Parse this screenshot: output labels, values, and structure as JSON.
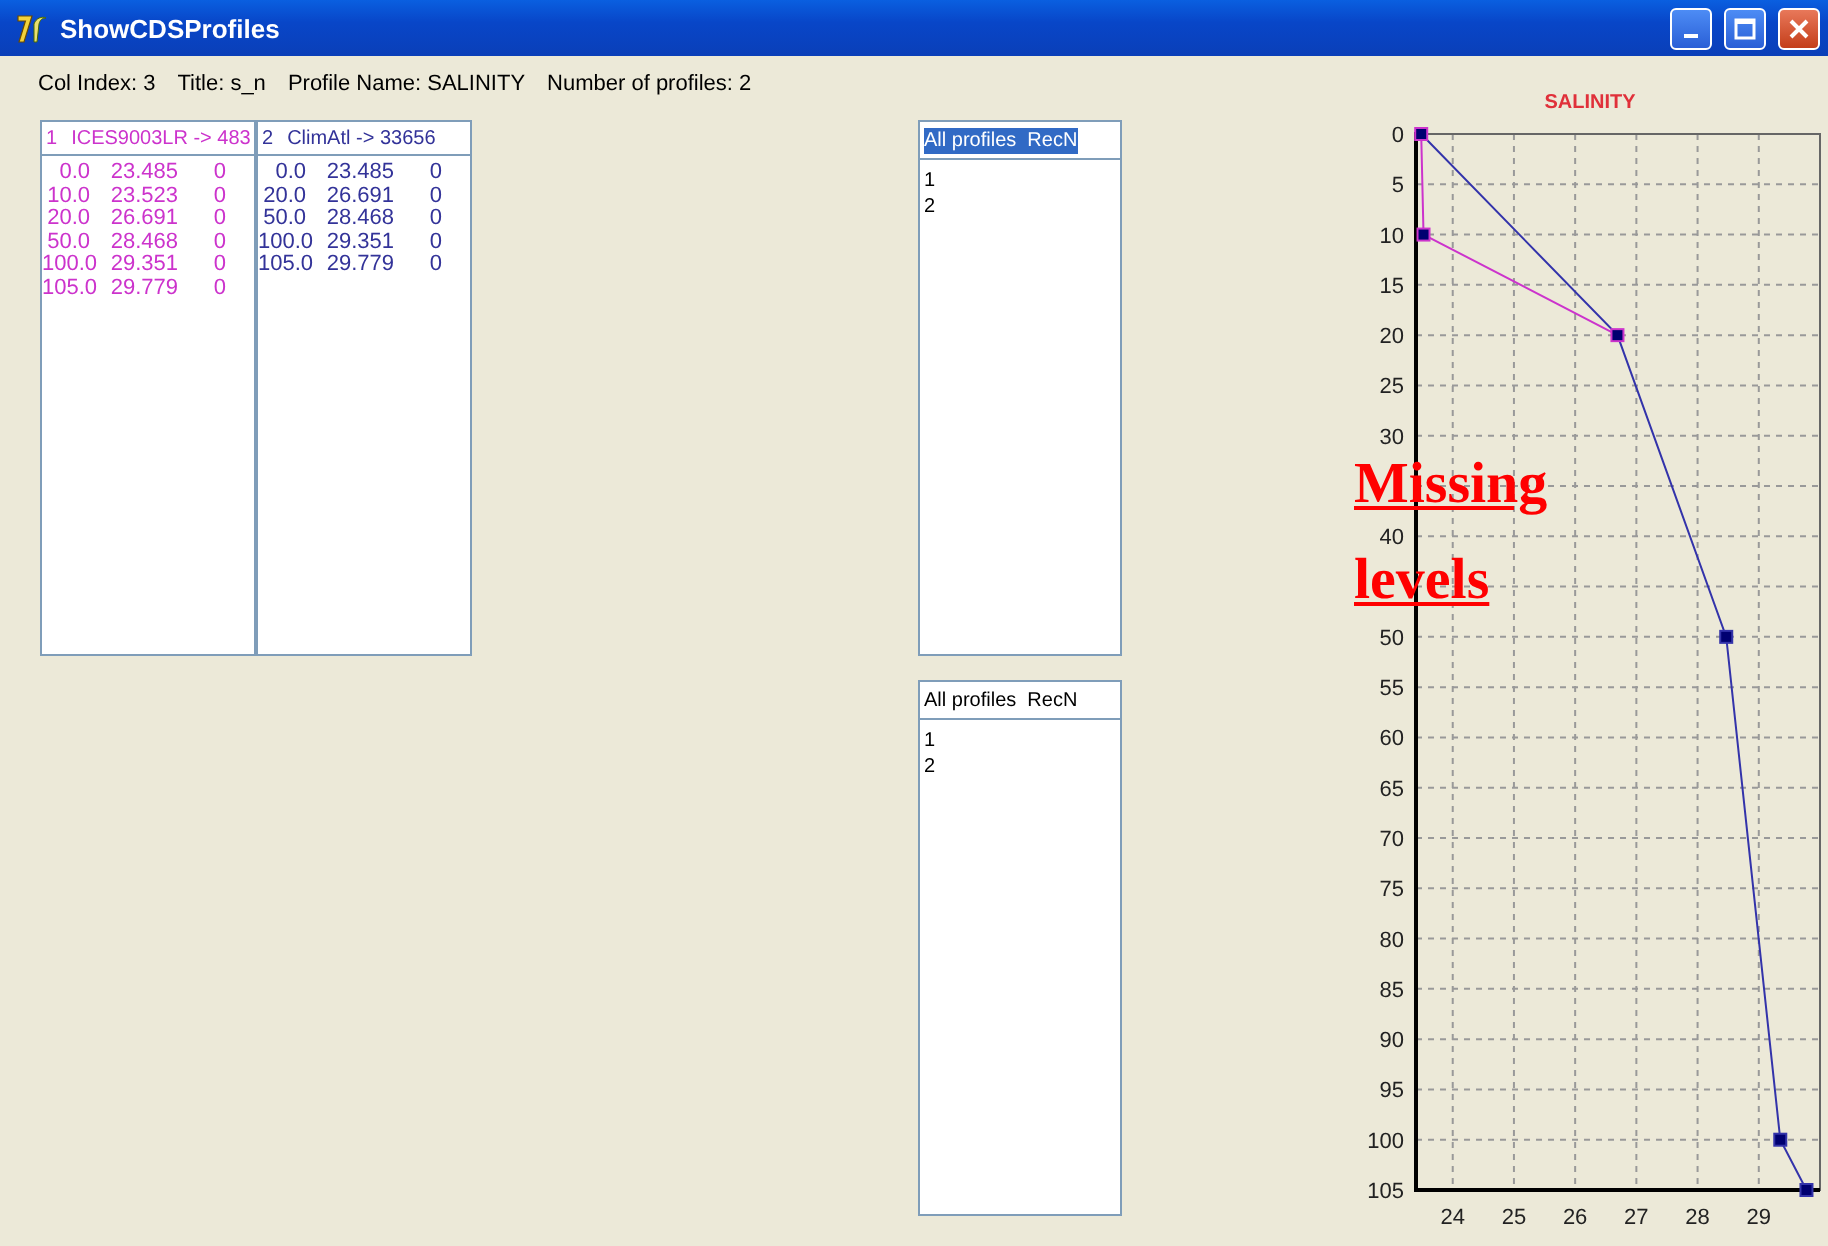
{
  "window": {
    "title": "ShowCDSProfiles"
  },
  "info": [
    {
      "label": "Col Index: 3"
    },
    {
      "label": "Title: s_n"
    },
    {
      "label": "Profile Name: SALINITY"
    },
    {
      "label": "Number of profiles: 2"
    }
  ],
  "profile_table": {
    "columns": [
      {
        "number": "1",
        "name": "ICES9003LR -> 483",
        "color": "#cc33cc",
        "rows": [
          [
            "0.0",
            "23.485",
            "0"
          ],
          [
            "10.0",
            "23.523",
            "0"
          ],
          [
            "20.0",
            "26.691",
            "0"
          ],
          [
            "50.0",
            "28.468",
            "0"
          ],
          [
            "100.0",
            "29.351",
            "0"
          ],
          [
            "105.0",
            "29.779",
            "0"
          ]
        ]
      },
      {
        "number": "2",
        "name": "ClimAtl -> 33656",
        "color": "#333399",
        "rows": [
          [
            "0.0",
            "23.485",
            "0"
          ],
          [
            "20.0",
            "26.691",
            "0"
          ],
          [
            "50.0",
            "28.468",
            "0"
          ],
          [
            "100.0",
            "29.351",
            "0"
          ],
          [
            "105.0",
            "29.779",
            "0"
          ]
        ]
      }
    ]
  },
  "lists": [
    {
      "header": {
        "label": "All profiles  RecN",
        "selected": true
      },
      "items": [
        "1",
        "2"
      ]
    },
    {
      "header": {
        "label": "All profiles  RecN",
        "selected": false
      },
      "items": [
        "1",
        "2"
      ]
    }
  ],
  "chart": {
    "annotation": [
      "Missing",
      "levels"
    ],
    "chart_data": {
      "type": "line",
      "title": "SALINITY",
      "grid": true,
      "xlim": [
        23.4,
        30
      ],
      "ylim": [
        105,
        0
      ],
      "xticks": [
        24,
        25,
        26,
        27,
        28,
        29
      ],
      "yticks": [
        0,
        5,
        10,
        15,
        20,
        25,
        30,
        40,
        50,
        55,
        60,
        65,
        70,
        75,
        80,
        85,
        90,
        95,
        100,
        105
      ],
      "series": [
        {
          "color": "#cc33cc",
          "marker": "square",
          "x": [
            23.485,
            23.523,
            26.691
          ],
          "values": [
            0,
            10,
            20
          ]
        },
        {
          "color": "#3333aa",
          "marker": "square",
          "x": [
            23.485,
            26.691,
            28.468,
            29.351,
            29.779
          ],
          "values": [
            0,
            20,
            50,
            100,
            105
          ]
        }
      ]
    }
  }
}
